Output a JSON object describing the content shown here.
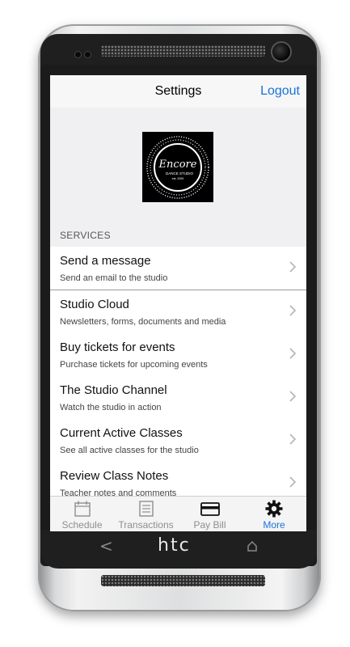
{
  "device": {
    "brand": "htc"
  },
  "navbar": {
    "title": "Settings",
    "logout_label": "Logout"
  },
  "logo": {
    "brand_text": "Encore",
    "sub_text": "DANCE STUDIO",
    "est_text": "est. 2009"
  },
  "services": {
    "header": "SERVICES",
    "items": [
      {
        "title": "Send a message",
        "subtitle": "Send an email to the studio"
      },
      {
        "title": "Studio Cloud",
        "subtitle": "Newsletters, forms, documents and media"
      },
      {
        "title": "Buy tickets for events",
        "subtitle": "Purchase tickets for upcoming events"
      },
      {
        "title": "The Studio Channel",
        "subtitle": "Watch the studio in action"
      },
      {
        "title": "Current Active Classes",
        "subtitle": "See all active classes for the studio"
      },
      {
        "title": "Review Class Notes",
        "subtitle": "Teacher notes and comments"
      }
    ]
  },
  "tabs": [
    {
      "label": "Schedule",
      "icon": "calendar-icon"
    },
    {
      "label": "Transactions",
      "icon": "list-icon"
    },
    {
      "label": "Pay Bill",
      "icon": "credit-card-icon"
    },
    {
      "label": "More",
      "icon": "gear-icon",
      "active": true
    }
  ],
  "colors": {
    "accent": "#1a73d8",
    "inactive_tab": "#8e8e8e"
  }
}
